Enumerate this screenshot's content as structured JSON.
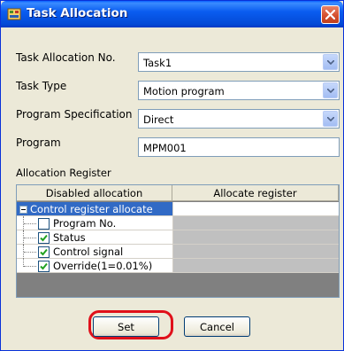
{
  "window": {
    "title": "Task Allocation"
  },
  "form": {
    "task_allocation_no": {
      "label": "Task Allocation No.",
      "value": "Task1"
    },
    "task_type": {
      "label": "Task Type",
      "value": "Motion program"
    },
    "program_specification": {
      "label": "Program Specification",
      "value": "Direct"
    },
    "program": {
      "label": "Program",
      "value": "MPM001"
    }
  },
  "allocation_register": {
    "label": "Allocation Register",
    "columns": [
      "Disabled allocation",
      "Allocate register"
    ],
    "group": "Control register allocate",
    "items": [
      {
        "label": "Program No.",
        "checked": false
      },
      {
        "label": "Status",
        "checked": true
      },
      {
        "label": "Control signal",
        "checked": true
      },
      {
        "label": "Override(1=0.01%)",
        "checked": true
      }
    ]
  },
  "buttons": {
    "set": "Set",
    "cancel": "Cancel"
  },
  "colors": {
    "titlebar": "#0a5df0",
    "highlight": "#e0101a",
    "selection": "#316ac5"
  }
}
